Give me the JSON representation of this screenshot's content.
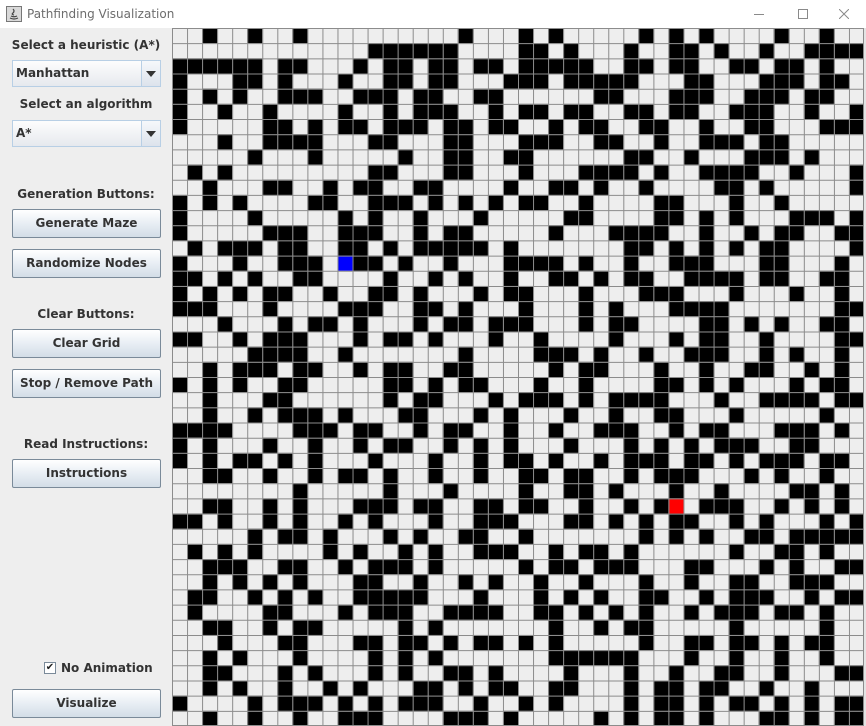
{
  "window": {
    "title": "Pathfinding Visualization",
    "minimize_icon": "minimize-icon",
    "maximize_icon": "maximize-icon",
    "close_icon": "close-icon"
  },
  "sidebar": {
    "heuristic_label": "Select a heuristic (A*)",
    "heuristic_value": "Manhattan",
    "algorithm_label": "Select an algorithm",
    "algorithm_value": "A*",
    "generation_label": "Generation Buttons:",
    "generate_maze": "Generate Maze",
    "randomize_nodes": "Randomize Nodes",
    "clear_label": "Clear Buttons:",
    "clear_grid": "Clear Grid",
    "stop_remove_path": "Stop / Remove Path",
    "instructions_label": "Read Instructions:",
    "instructions": "Instructions",
    "no_animation_label": "No Animation",
    "no_animation_checked": true,
    "visualize": "Visualize"
  },
  "grid": {
    "cols": 46,
    "rows": 46,
    "colors": {
      "wall": "#000000",
      "empty": "#eeeeee",
      "line": "#8c8c8c",
      "start": "#0000ff",
      "end": "#ff0000"
    },
    "start": {
      "col": 11,
      "row": 15
    },
    "end": {
      "col": 33,
      "row": 31
    },
    "walls": [
      "..#..#..#..........#...#.#.....#.#.#....#..#..",
      ".............######....##.#...#..##.#..#..####",
      "######.##...#.##.##.##.#####..##.##..##.##.#..",
      "#...##.#...#..##.##...###.#####...##...###.##.",
      "#.#.#..###..###.##..##......##...###..###.##..",
      "#..#..#....#..#.###..#.##.##..##.##..###..#..#",
      "#.....##.#.##.###.##.##..#.##..##..#..##...###",
      "...#..####...##...##...###..##..#..###.##.....",
      ".....#...#.....#..##..##......##..#...###.#...",
      ".#.#.........##...##...#...####.#..####..#...#",
      "..#...##..#.##..##....#..##.#..#....##.#.....#",
      "#.#.#....##..###.#.#.#.##..#....##...#..#.....",
      "#....#.....#.#..#...#.....##....##.#.#...###.#",
      "#.....###..###..#.##.....#...####..#..#.##..##",
      ".#.###.##..##.#.#####.#.......##.#.#.#.##....#",
      "#...#..###..##.#..#...####.#..#..###...##...#.",
      "##.#.#..##....#..#.#..#..##.#.##..####.##..##.",
      "#.#.#.##..#..##.#...#.##...#...###...#...#..#.",
      "###...#....###..##.#...#...#.#...####.......##",
      "...#...#.##.#...#.##.###...#.##....##.#.#..##.",
      "##..#.###...#.##.#...#..#....#...#.##..#....##",
      ".....####..#.......#....###.#..#..###..#.#..#.",
      "..#.###.##..#.##..##.....#.##...#..#..##..#.#.",
      "#.#.#..##.....##.#.##...#..#....##.#.#...#.##.",
      "..#...##......#.##...#.###.#.####...#..####.##",
      "..#..#.###.#...##...#.#...#..#..##...#.....#..",
      "####....###.##..#.##..#..#..###..#.##...###.#.",
      "#.#...#..#..#.##..#.#.#...#...#.#.#.###..##...",
      "#.#.##.#.#...#...#..#.##.#..#.###.##.#.###.##.",
      "..##..#..#.##.#..#..#..##.##..#.###...#.#..#..",
      "........#.....#...#....#..##.#...#..#....##.#.",
      "..##..#.#...###.##..##.##..#..#.#..###..#.#.#.",
      "##.#..#.#..#.#...#..###...##.#.#.##..#.#...#.#",
      ".....#.##.#...#.#..##..#.......#.#.#..##.#####",
      ".#.#.#....#.#..#.#..###..#.##.#......#..##.#..",
      "..###..##..#.###.#.....#.##.###...##...#.#..##",
      "..#.#.#.#...##..#..#.#..#..#...#..#..##..###..",
      ".##..#.#.#..#####...#...#.#.#..##..#.###..#.##",
      ".#....##...#.###..####..##.#.#.#..#.###.##.#..",
      "..##..#.##.....#.#.......#..#.##.....#.....#..",
      "...#...##...##.##.#.##.#.#.....#..##.##.#.##..",
      "..#.#...#....#.#.#.......######...#..#..#..#..",
      "..##...#.#...#.#..##.#....#...#..#..##..#...##",
      "..#.#..#..#.#...##.#.##..##...#.##.##..#..#...",
      "#....#.###.#.#.###..#..#.#....#.##.#.##.#.#.##",
      "..#..#..#..###....###.#.....#.#.##.#...##.#.##"
    ]
  }
}
